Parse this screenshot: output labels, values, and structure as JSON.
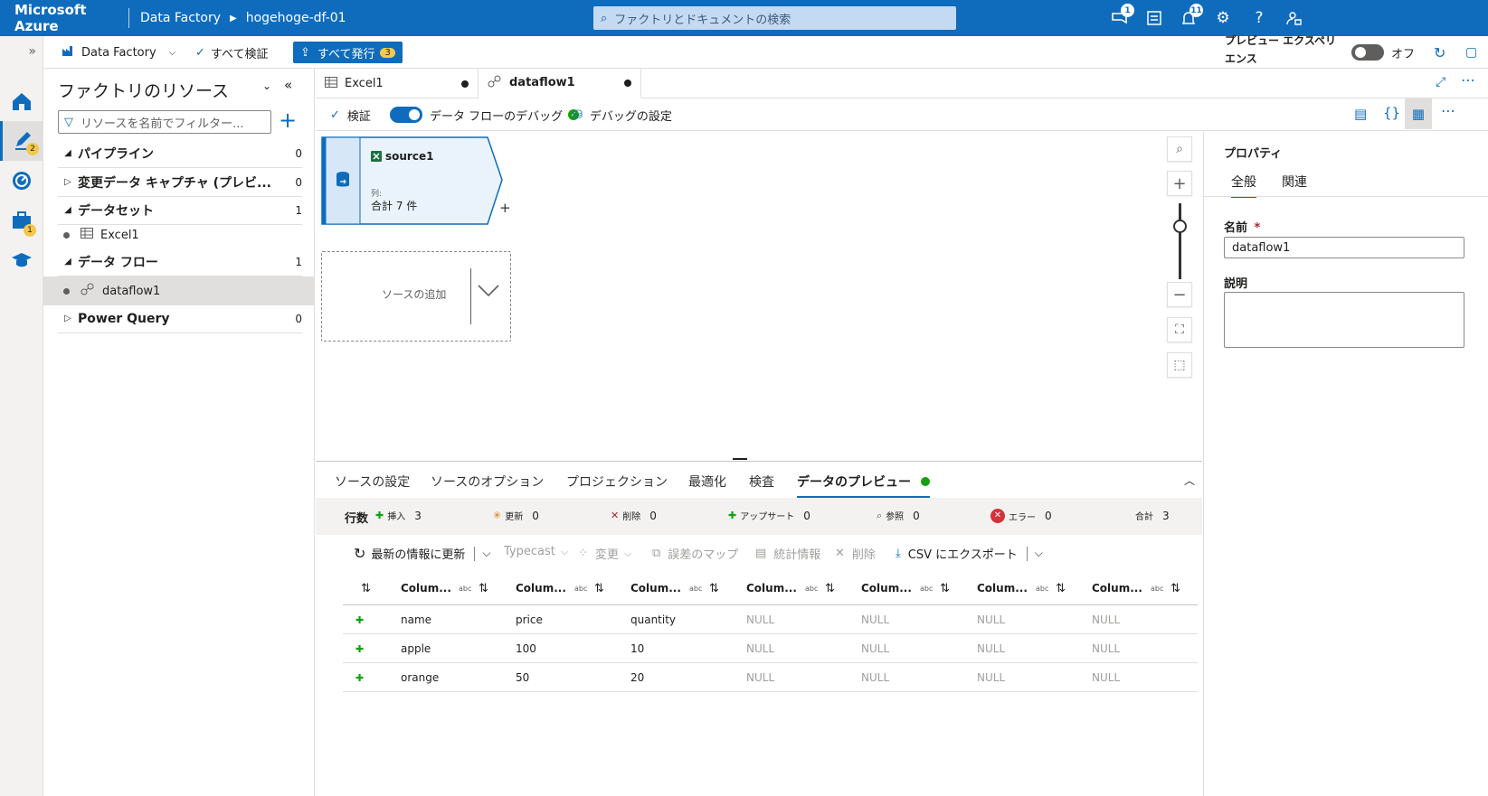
{
  "topbar": {
    "brand": "Microsoft Azure",
    "crumb1": "Data Factory",
    "crumb2": "hogehoge-df-01",
    "search_placeholder": "ファクトリとドキュメントの検索",
    "badge_feedback": "1",
    "badge_notifications": "11"
  },
  "rail": {
    "expand": "»",
    "author_badge": "2",
    "manage_badge": "1"
  },
  "toolbar": {
    "factory_label": "Data Factory",
    "validate_all": "すべて検証",
    "publish_all": "すべて発行",
    "publish_count": "3",
    "preview_experience": "プレビュー エクスペリエンス",
    "preview_state": "オフ"
  },
  "resources": {
    "title": "ファクトリのリソース",
    "filter_placeholder": "リソースを名前でフィルター...",
    "sections": [
      {
        "label": "パイプライン",
        "count": "0"
      },
      {
        "label": "変更データ キャプチャ (プレビ...",
        "count": "0"
      },
      {
        "label": "データセット",
        "count": "1"
      },
      {
        "label": "データ フロー",
        "count": "1"
      },
      {
        "label": "Power Query",
        "count": "0"
      }
    ],
    "dataset_item": "Excel1",
    "dataflow_item": "dataflow1"
  },
  "tabs": [
    {
      "label": "Excel1"
    },
    {
      "label": "dataflow1"
    }
  ],
  "dataflow_toolbar": {
    "validate": "検証",
    "debug": "データ フローのデバッグ",
    "debug_settings": "デバッグの設定"
  },
  "canvas": {
    "node_name": "source1",
    "node_cols_label": "列:",
    "node_cols_value": "合計 7 件",
    "add_source": "ソースの追加"
  },
  "properties": {
    "title": "プロパティ",
    "tab_general": "全般",
    "tab_related": "関連",
    "name_label": "名前",
    "required_mark": "*",
    "name_value": "dataflow1",
    "description_label": "説明"
  },
  "bottom": {
    "tabs": [
      "ソースの設定",
      "ソースのオプション",
      "プロジェクション",
      "最適化",
      "検査",
      "データのプレビュー"
    ],
    "stats": {
      "rows_label": "行数",
      "insert_label": "挿入",
      "insert_value": "3",
      "update_label": "更新",
      "update_value": "0",
      "delete_label": "削除",
      "delete_value": "0",
      "upsert_label": "アップサート",
      "upsert_value": "0",
      "lookup_label": "参照",
      "lookup_value": "0",
      "error_label": "エラー",
      "error_value": "0",
      "total_label": "合計",
      "total_value": "3"
    },
    "actions": {
      "refresh": "最新の情報に更新",
      "typecast": "Typecast",
      "modify": "変更",
      "map_drifted": "誤差のマップ",
      "statistics": "統計情報",
      "remove": "削除",
      "export_csv": "CSV にエクスポート"
    },
    "grid": {
      "headers": [
        "Colum...",
        "Colum...",
        "Colum...",
        "Colum...",
        "Colum...",
        "Colum...",
        "Colum..."
      ],
      "type_label": "abc",
      "rows": [
        [
          "name",
          "price",
          "quantity",
          "NULL",
          "NULL",
          "NULL",
          "NULL"
        ],
        [
          "apple",
          "100",
          "10",
          "NULL",
          "NULL",
          "NULL",
          "NULL"
        ],
        [
          "orange",
          "50",
          "20",
          "NULL",
          "NULL",
          "NULL",
          "NULL"
        ]
      ]
    }
  }
}
